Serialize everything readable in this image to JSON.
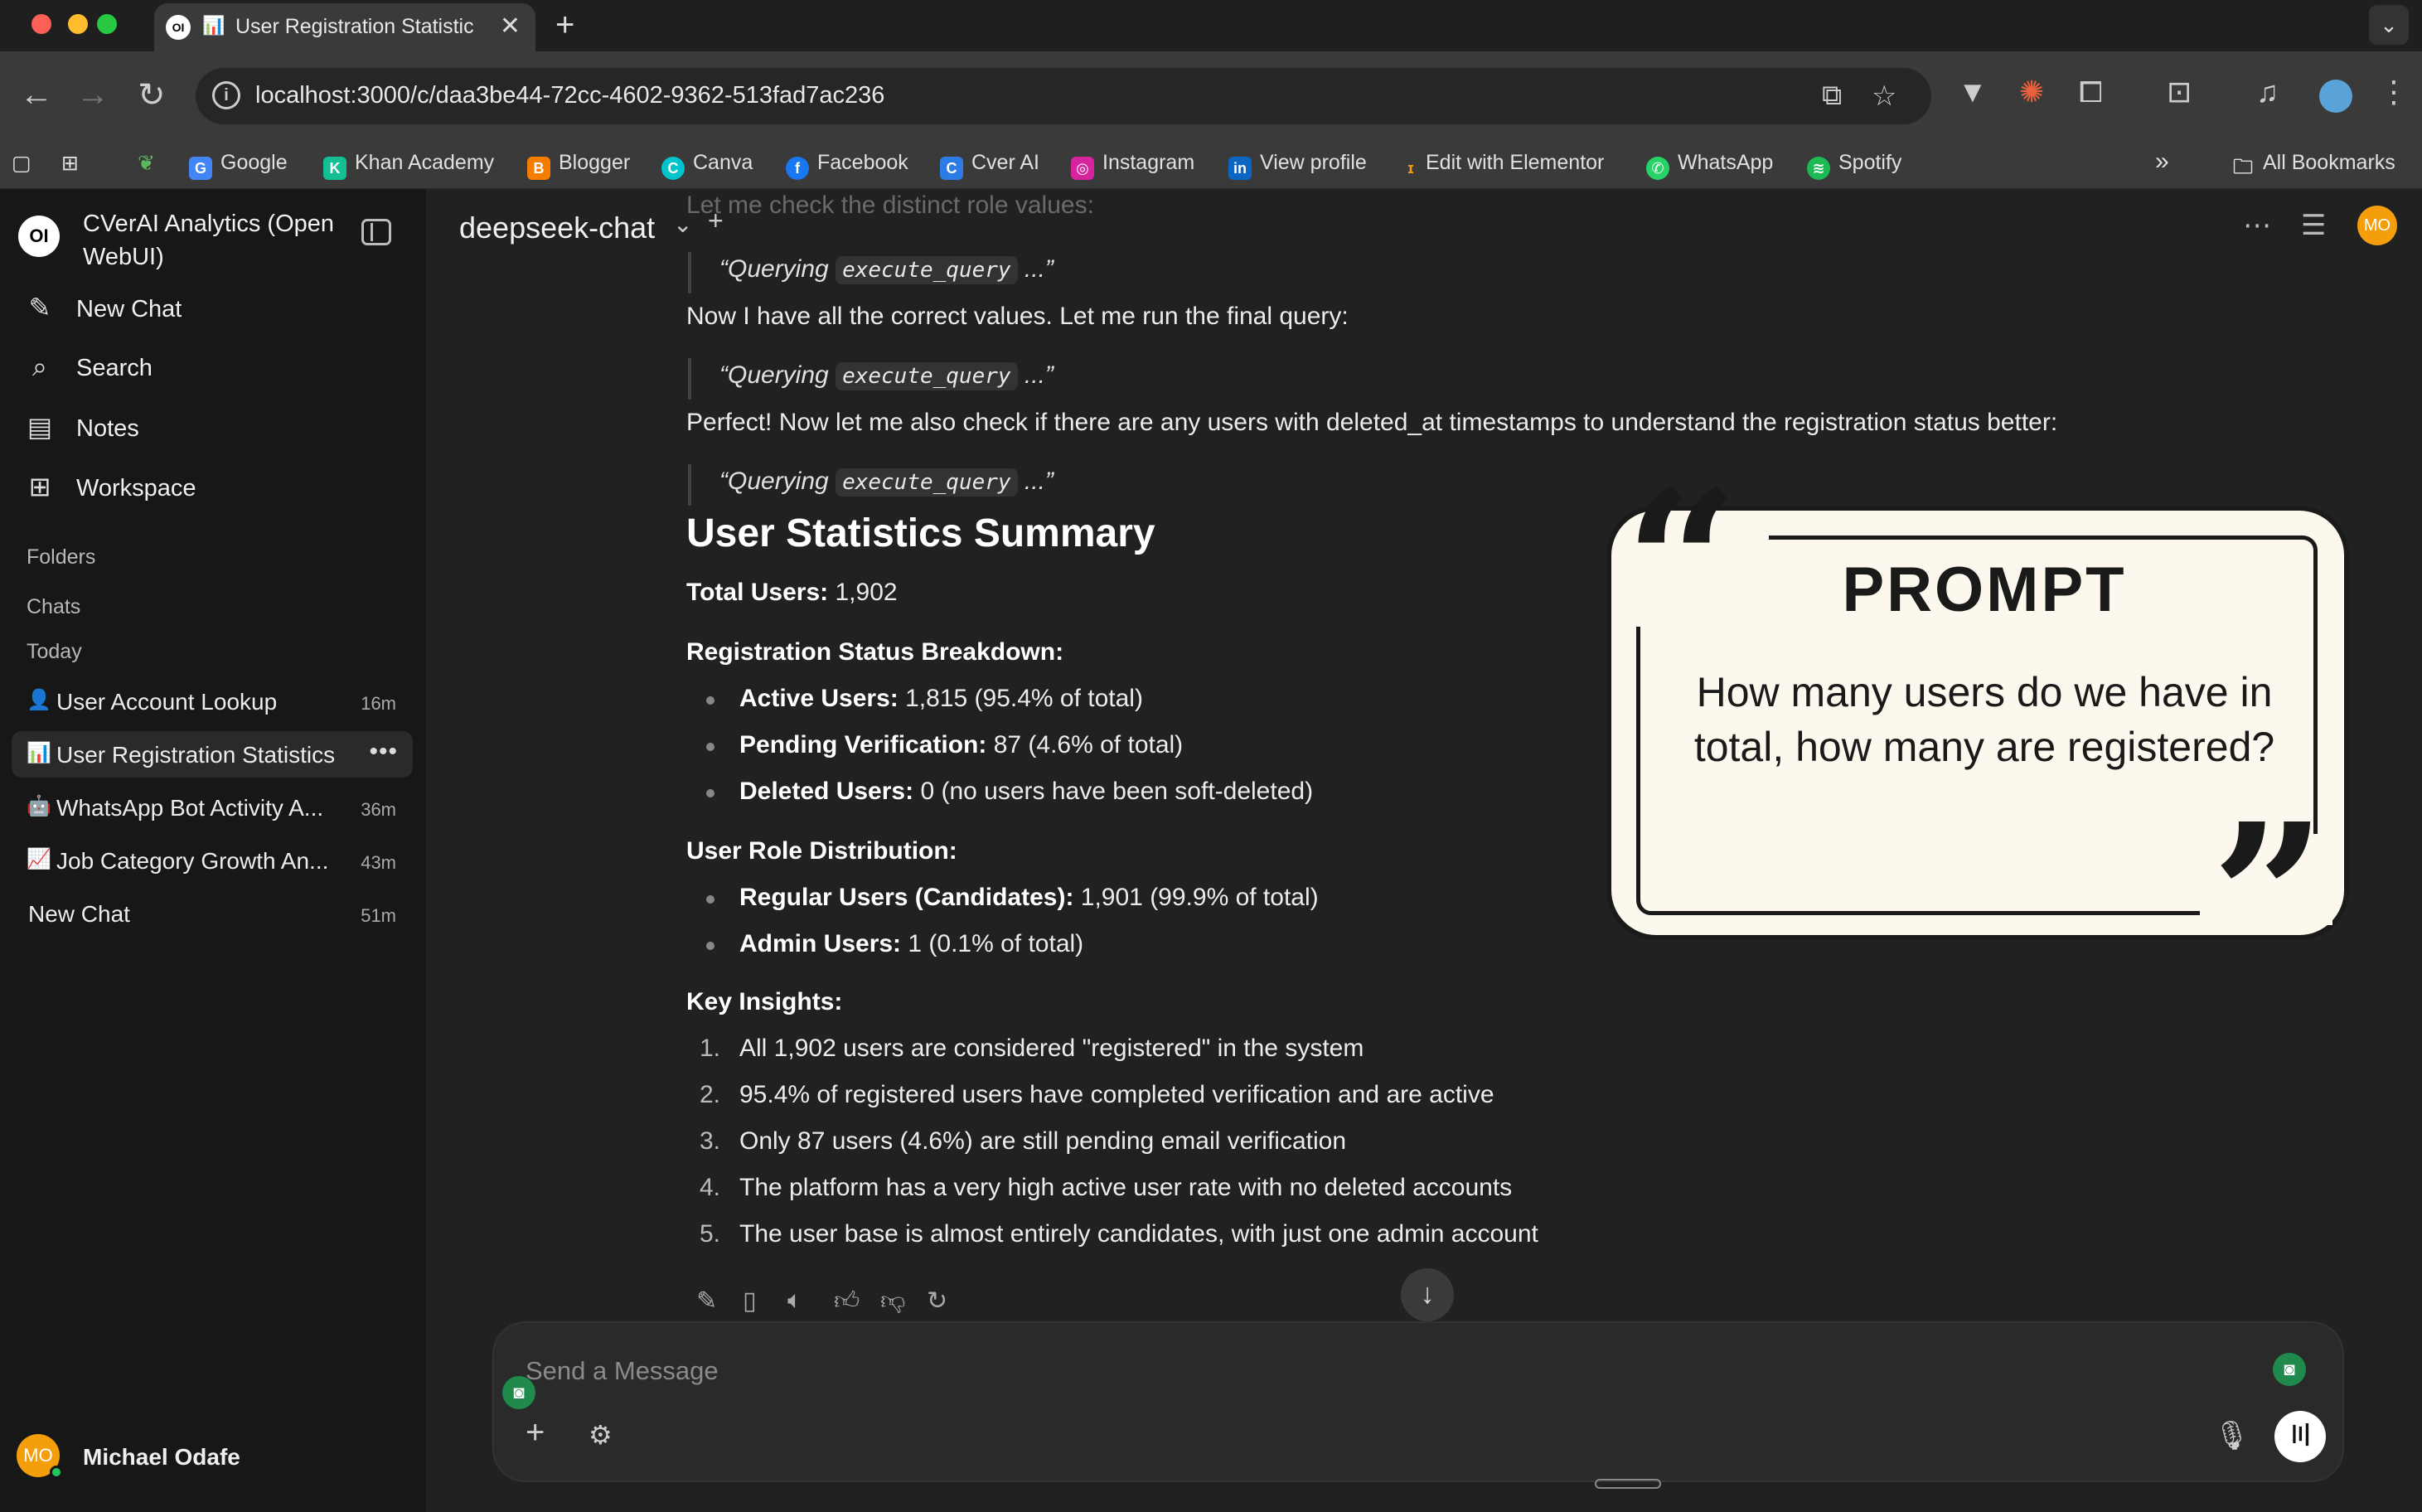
{
  "browser": {
    "tab_title": "User Registration Statistic",
    "tab_logo": "OI",
    "url": "localhost:3000/c/daa3be44-72cc-4602-9362-513fad7ac236",
    "bookmarks": [
      "Google",
      "Khan Academy",
      "Blogger",
      "Canva",
      "Facebook",
      "Cver AI",
      "Instagram",
      "View profile",
      "Edit with Elementor",
      "WhatsApp",
      "Spotify"
    ],
    "all_bookmarks": "All Bookmarks"
  },
  "sidebar": {
    "logo": "OI",
    "app_title": "CVerAI Analytics (Open WebUI)",
    "nav": {
      "new_chat": "New Chat",
      "search": "Search",
      "notes": "Notes",
      "workspace": "Workspace"
    },
    "sections": {
      "folders": "Folders",
      "chats": "Chats",
      "today": "Today"
    },
    "chats": [
      {
        "emoji": "👤",
        "title": "User Account Lookup",
        "time": "16m"
      },
      {
        "emoji": "📊",
        "title": "User Registration Statistics",
        "time": ""
      },
      {
        "emoji": "🤖",
        "title": "WhatsApp Bot Activity A...",
        "time": "36m"
      },
      {
        "emoji": "📈",
        "title": "Job Category Growth An...",
        "time": "43m"
      },
      {
        "emoji": "",
        "title": "New Chat",
        "time": "51m"
      }
    ],
    "user": {
      "initials": "MO",
      "name": "Michael Odafe"
    }
  },
  "header": {
    "model": "deepseek-chat",
    "avatar": "MO"
  },
  "conversation": {
    "faded_line": "Let me check the distinct role values:",
    "quote_prefix": "“Querying",
    "quote_code": "execute_query",
    "quote_suffix": "...”",
    "line_1": "Now I have all the correct values. Let me run the final query:",
    "line_2": "Perfect! Now let me also check if there are any users with deleted_at timestamps to understand the registration status better:",
    "summary_title": "User Statistics Summary",
    "total_label": "Total Users:",
    "total_value": "1,902",
    "reg_heading": "Registration Status Breakdown:",
    "reg_items": [
      {
        "label": "Active Users:",
        "value": "1,815 (95.4% of total)"
      },
      {
        "label": "Pending Verification:",
        "value": "87 (4.6% of total)"
      },
      {
        "label": "Deleted Users:",
        "value": "0 (no users have been soft-deleted)"
      }
    ],
    "role_heading": "User Role Distribution:",
    "role_items": [
      {
        "label": "Regular Users (Candidates):",
        "value": "1,901 (99.9% of total)"
      },
      {
        "label": "Admin Users:",
        "value": "1 (0.1% of total)"
      }
    ],
    "insights_heading": "Key Insights:",
    "insights": [
      "All 1,902 users are considered \"registered\" in the system",
      "95.4% of registered users have completed verification and are active",
      "Only 87 users (4.6%) are still pending email verification",
      "The platform has a very high active user rate with no deleted accounts",
      "The user base is almost entirely candidates, with just one admin account"
    ]
  },
  "prompt_card": {
    "title": "PROMPT",
    "text": "How many users do we have in total, how many are registered?"
  },
  "composer": {
    "placeholder": "Send a Message"
  }
}
